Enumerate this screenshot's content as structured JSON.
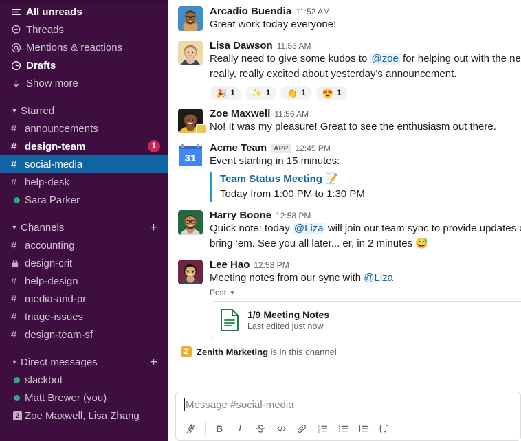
{
  "sidebar": {
    "nav": [
      {
        "label": "All unreads",
        "icon": "unreads-icon",
        "bold": true
      },
      {
        "label": "Threads",
        "icon": "threads-icon",
        "bold": false
      },
      {
        "label": "Mentions & reactions",
        "icon": "mentions-icon",
        "bold": false
      },
      {
        "label": "Drafts",
        "icon": "drafts-clock-icon",
        "bold": true
      },
      {
        "label": "Show more",
        "icon": "show-more-arrow-icon",
        "bold": false
      }
    ],
    "sections": [
      {
        "title": "Starred",
        "has_add": false,
        "items": [
          {
            "name": "announcements",
            "kind": "hash",
            "unread": false,
            "active": false,
            "badge": null
          },
          {
            "name": "design-team",
            "kind": "hash",
            "unread": true,
            "active": false,
            "badge": "1"
          },
          {
            "name": "social-media",
            "kind": "hash",
            "unread": false,
            "active": true,
            "badge": null
          },
          {
            "name": "help-desk",
            "kind": "hash",
            "unread": false,
            "active": false,
            "badge": null
          },
          {
            "name": "Sara Parker",
            "kind": "presence",
            "unread": false,
            "active": false,
            "badge": null
          }
        ]
      },
      {
        "title": "Channels",
        "has_add": true,
        "add_label": "+",
        "items": [
          {
            "name": "accounting",
            "kind": "hash",
            "unread": false,
            "active": false,
            "badge": null
          },
          {
            "name": "design-crit",
            "kind": "lock",
            "unread": false,
            "active": false,
            "badge": null
          },
          {
            "name": "help-design",
            "kind": "hash",
            "unread": false,
            "active": false,
            "badge": null
          },
          {
            "name": "media-and-pr",
            "kind": "hash",
            "unread": false,
            "active": false,
            "badge": null
          },
          {
            "name": "triage-issues",
            "kind": "hash",
            "unread": false,
            "active": false,
            "badge": null
          },
          {
            "name": "design-team-sf",
            "kind": "hash",
            "unread": false,
            "active": false,
            "badge": null
          }
        ]
      },
      {
        "title": "Direct messages",
        "has_add": true,
        "add_label": "+",
        "items": [
          {
            "name": "slackbot",
            "kind": "presence",
            "unread": false,
            "active": false,
            "badge": null
          },
          {
            "name": "Matt Brewer (you)",
            "kind": "presence",
            "unread": false,
            "active": false,
            "badge": null
          },
          {
            "name": "Zoe Maxwell, Lisa Zhang",
            "kind": "group",
            "group_count": "2",
            "unread": false,
            "active": false,
            "badge": null
          }
        ]
      }
    ]
  },
  "messages": [
    {
      "author": "Arcadio Buendia",
      "time": "11:52 AM",
      "app_tag": null,
      "avatar_kind": "photo-male-beard",
      "text": "Great work today everyone!",
      "reactions": []
    },
    {
      "author": "Lisa Dawson",
      "time": "11:55 AM",
      "app_tag": null,
      "avatar_kind": "photo-female-blonde",
      "text_part1": "Really need to give some kudos to ",
      "mention": "@zoe",
      "text_part2": " for helping out with the new influx o",
      "text_line2": "really, really excited about yesterday's announcement.",
      "reactions": [
        {
          "emoji": "🎉",
          "count": "1",
          "name": "tada"
        },
        {
          "emoji": "✨",
          "count": "1",
          "name": "sparkles"
        },
        {
          "emoji": "👏",
          "count": "1",
          "name": "clap"
        },
        {
          "emoji": "😍",
          "count": "1",
          "name": "heart-eyes"
        }
      ]
    },
    {
      "author": "Zoe Maxwell",
      "time": "11:56 AM",
      "app_tag": null,
      "avatar_kind": "photo-female-dark",
      "has_status_emoji": true,
      "text": "No! It was my pleasure! Great to see the enthusiasm out there.",
      "reactions": []
    },
    {
      "author": "Acme Team",
      "time": "12:45 PM",
      "app_tag": "APP",
      "avatar_kind": "calendar",
      "calendar_day": "31",
      "text": "Event starting in 15 minutes:",
      "attachment": {
        "title": "Team Status Meeting 📝",
        "subtitle": "Today from 1:00 PM to 1:30 PM"
      }
    },
    {
      "author": "Harry Boone",
      "time": "12:58 PM",
      "app_tag": null,
      "avatar_kind": "photo-male-glasses",
      "text_part1": "Quick note: today ",
      "mention": "@Liza",
      "text_part2": " will join our team sync to provide updates on the lau",
      "text_line2": "bring ‘em. See you all later... er, in 2 minutes 😅"
    },
    {
      "author": "Lee Hao",
      "time": "12:58 PM",
      "app_tag": null,
      "avatar_kind": "photo-male-asian",
      "text_part1": "Meeting notes from our sync with ",
      "mention_plain": "@Liza",
      "post_label": "Post",
      "file": {
        "name": "1/9 Meeting Notes",
        "meta": "Last edited just now",
        "icon": "document-icon"
      }
    }
  ],
  "join_notice": {
    "badge_letter": "Z",
    "name": "Zenith Marketing",
    "suffix": " is in this channel"
  },
  "composer": {
    "placeholder": "Message #social-media",
    "value": "",
    "tools": [
      {
        "name": "shortcuts-lightning-icon",
        "glyph": "lightning"
      },
      {
        "name": "bold-button",
        "glyph": "B"
      },
      {
        "name": "italic-button",
        "glyph": "I"
      },
      {
        "name": "strikethrough-button",
        "glyph": "S"
      },
      {
        "name": "code-button",
        "glyph": "</>"
      },
      {
        "name": "link-button",
        "glyph": "link"
      },
      {
        "name": "ordered-list-button",
        "glyph": "ol"
      },
      {
        "name": "bulleted-list-button",
        "glyph": "ul"
      },
      {
        "name": "blockquote-button",
        "glyph": "quote"
      },
      {
        "name": "code-block-button",
        "glyph": "codeblock"
      }
    ]
  },
  "colors": {
    "sidebar_bg": "#3F0E40",
    "active_item": "#1164A3",
    "badge_red": "#CD2553",
    "presence_green": "#2BAC76",
    "link_blue": "#1264A3",
    "mention_bg": "#E8F5FA",
    "app_badge_yellow": "#ECB22E",
    "quote_bar": "#1D9BD1"
  }
}
